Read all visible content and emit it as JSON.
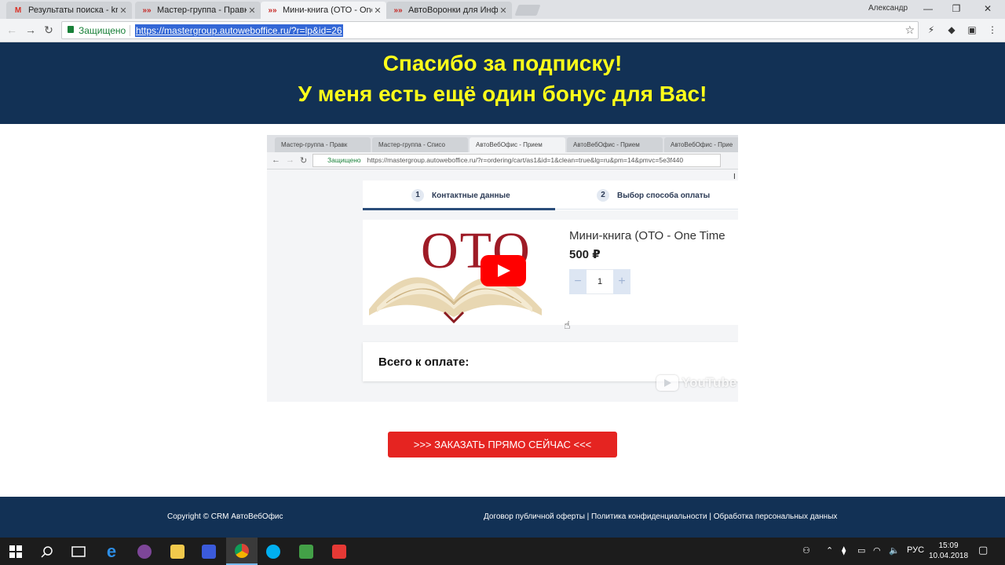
{
  "browser": {
    "tabs": [
      {
        "title": "Результаты поиска - kru",
        "icon": "gmail-icon",
        "active": false
      },
      {
        "title": "Мастер-группа - Правк",
        "icon": "autoweboffice-icon",
        "active": false
      },
      {
        "title": "Мини-книга (ОТО - One",
        "icon": "autoweboffice-icon",
        "active": true
      },
      {
        "title": "АвтоВоронки для Инфо",
        "icon": "autoweboffice-icon",
        "active": false
      }
    ],
    "profile_name": "Александр",
    "secure_label": "Защищено",
    "url": "https://mastergroup.autoweboffice.ru/?r=lp&id=26"
  },
  "page": {
    "header_line1": "Спасибо за подписку!",
    "header_line2": "У меня есть ещё один бонус для Вас!",
    "cta_label": ">>> ЗАКАЗАТЬ ПРЯМО СЕЙЧАС <<<",
    "footer_copyright": "Copyright © CRM АвтоВебОфис",
    "footer_links": "Договор публичной оферты | Политика конфиденциальности | Обработка персональных данных"
  },
  "video": {
    "tabs": [
      "Мастер-группа - Правк",
      "Мастер-группа - Списо",
      "АвтоВебОфис - Прием",
      "АвтоВебОфис - Прием",
      "АвтоВебОфис - Прие"
    ],
    "secure_label": "Защищено",
    "url": "https://mastergroup.autoweboffice.ru/?r=ordering/cart/as1&id=1&clean=true&lg=ru&pm=14&pmvc=5e3f440",
    "step1_num": "1",
    "step1_label": "Контактные данные",
    "step2_num": "2",
    "step2_label": "Выбор способа оплаты",
    "thumbnail_text": "ОТО",
    "product_name": "Мини-книга (ОТО - One Time",
    "product_price": "500 ₽",
    "quantity": "1",
    "qty_minus": "−",
    "qty_plus": "+",
    "total_label": "Всего к оплате:",
    "watermark": "YouTube"
  },
  "taskbar": {
    "keyboard_lang": "РУС",
    "time": "15:09",
    "date": "10.04.2018"
  },
  "colors": {
    "header_bg": "#123155",
    "header_text": "#ffff1a",
    "cta_bg": "#e52421",
    "footer_bg": "#123155"
  }
}
